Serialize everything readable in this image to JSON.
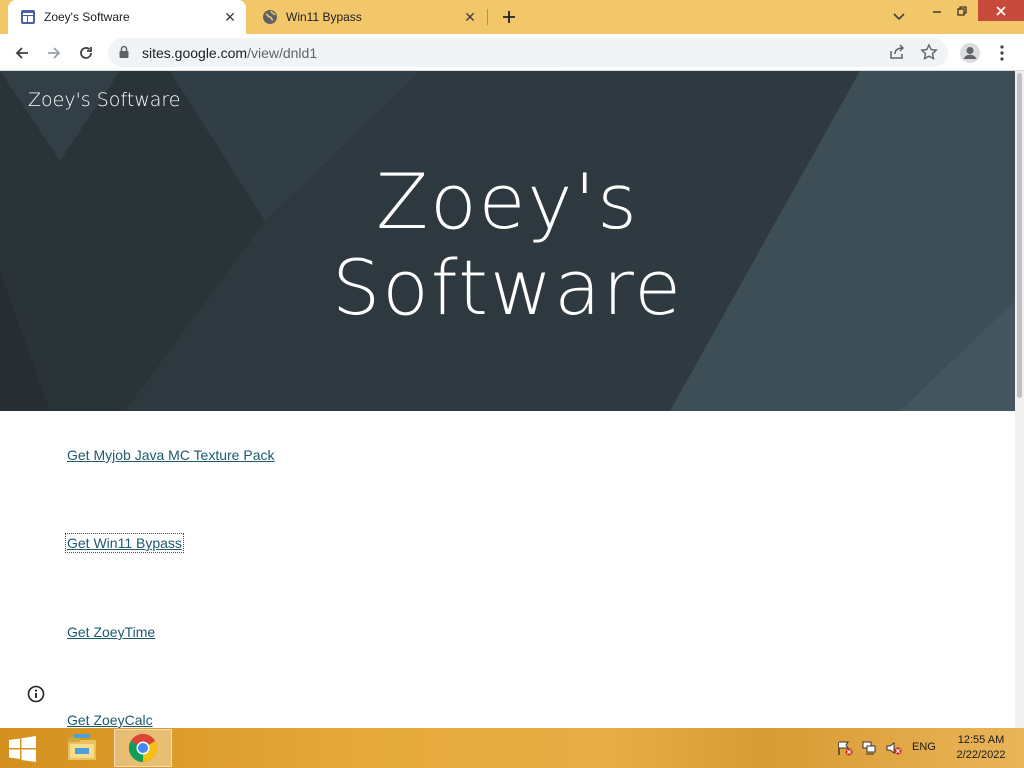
{
  "browser": {
    "tabs": [
      {
        "title": "Zoey's Software",
        "active": true,
        "favicon": "google-sites-icon"
      },
      {
        "title": "Win11 Bypass",
        "active": false,
        "favicon": "globe-icon"
      }
    ],
    "url_host": "sites.google.com",
    "url_path": "/view/dnld1"
  },
  "site": {
    "name": "Zoey's Software",
    "hero_line1": "Zoey's",
    "hero_line2": "Software",
    "links": [
      {
        "label": "Get Myjob Java MC Texture Pack"
      },
      {
        "label": "Get Win11 Bypass"
      },
      {
        "label": "Get ZoeyTime"
      },
      {
        "label": "Get ZoeyCalc"
      }
    ]
  },
  "taskbar": {
    "apps": [
      "file-explorer-icon",
      "chrome-icon"
    ],
    "language": "ENG",
    "time": "12:55 AM",
    "date": "2/22/2022"
  },
  "colors": {
    "tabstrip": "#f2c769",
    "hero_bg": "#2f3b42",
    "link": "#1e5a6e",
    "close_button": "#c74a3c"
  }
}
